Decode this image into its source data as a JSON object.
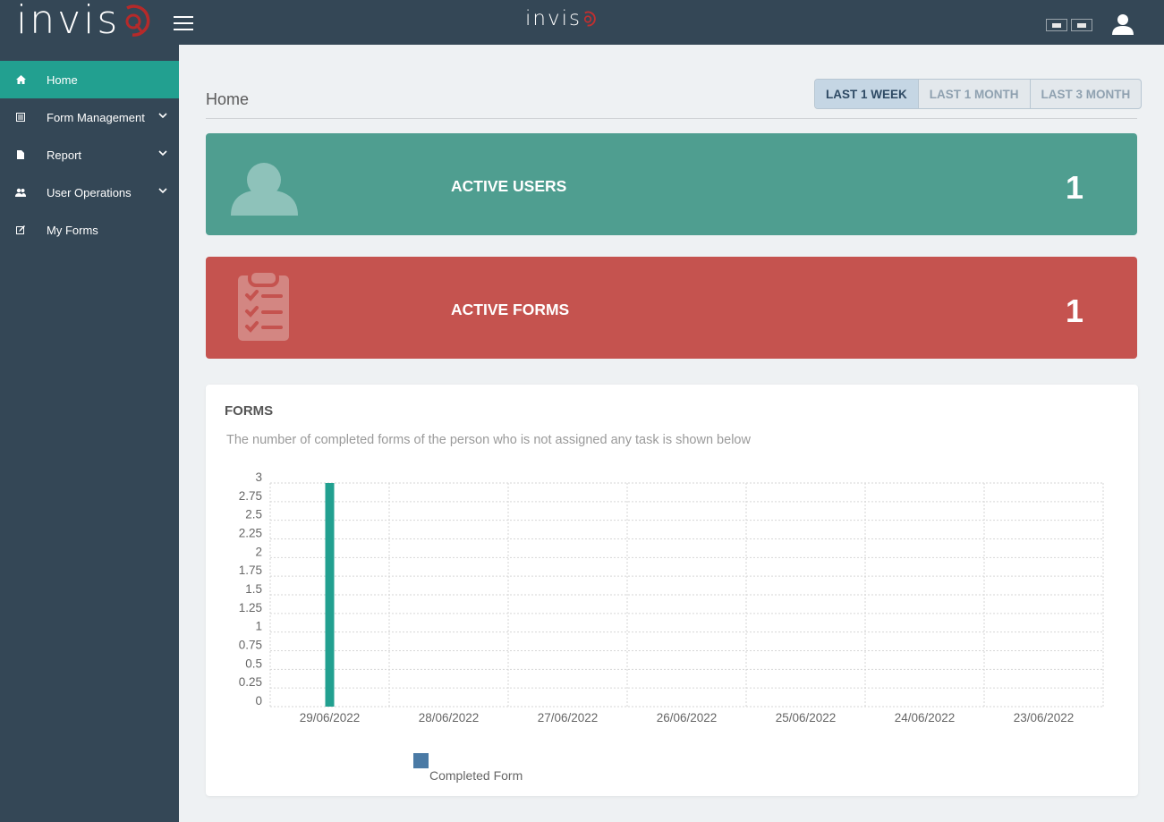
{
  "header": {
    "logo_text": "invis",
    "center_logo_text": "invis",
    "menu_icon": "hamburger-icon",
    "flag_icons": [
      "language-flag-icon",
      "language-flag-icon"
    ],
    "user_icon": "user-icon"
  },
  "sidebar": {
    "items": [
      {
        "label": "Home",
        "icon": "home-icon",
        "active": true,
        "expandable": false
      },
      {
        "label": "Form Management",
        "icon": "list-icon",
        "active": false,
        "expandable": true
      },
      {
        "label": "Report",
        "icon": "file-icon",
        "active": false,
        "expandable": true
      },
      {
        "label": "User Operations",
        "icon": "users-icon",
        "active": false,
        "expandable": true
      },
      {
        "label": "My Forms",
        "icon": "edit-icon",
        "active": false,
        "expandable": false
      }
    ]
  },
  "page": {
    "title": "Home",
    "range_buttons": [
      {
        "label": "LAST 1 WEEK",
        "active": true
      },
      {
        "label": "LAST 1 MONTH",
        "active": false
      },
      {
        "label": "LAST 3 MONTH",
        "active": false
      }
    ]
  },
  "stats": {
    "users": {
      "label": "ACTIVE USERS",
      "value": "1",
      "icon": "user-icon",
      "color": "#4f9e90"
    },
    "forms": {
      "label": "ACTIVE FORMS",
      "value": "1",
      "icon": "clipboard-checklist-icon",
      "color": "#c5534f"
    }
  },
  "forms_panel": {
    "title": "FORMS",
    "subtitle": "The number of completed forms of the person who is not assigned any task is shown below"
  },
  "chart_data": {
    "type": "bar",
    "title": "",
    "xlabel": "",
    "ylabel": "",
    "categories": [
      "29/06/2022",
      "28/06/2022",
      "27/06/2022",
      "26/06/2022",
      "25/06/2022",
      "24/06/2022",
      "23/06/2022"
    ],
    "series": [
      {
        "name": "Completed Form",
        "values": [
          3,
          0,
          0,
          0,
          0,
          0,
          0
        ],
        "color": "#22a090",
        "legend_color": "#4a7aa5"
      }
    ],
    "ylim": [
      0,
      3
    ],
    "yticks": [
      "0",
      "0.25",
      "0.5",
      "0.75",
      "1",
      "1.25",
      "1.5",
      "1.75",
      "2",
      "2.25",
      "2.5",
      "2.75",
      "3"
    ],
    "grid": true,
    "legend": "bottom-left"
  }
}
